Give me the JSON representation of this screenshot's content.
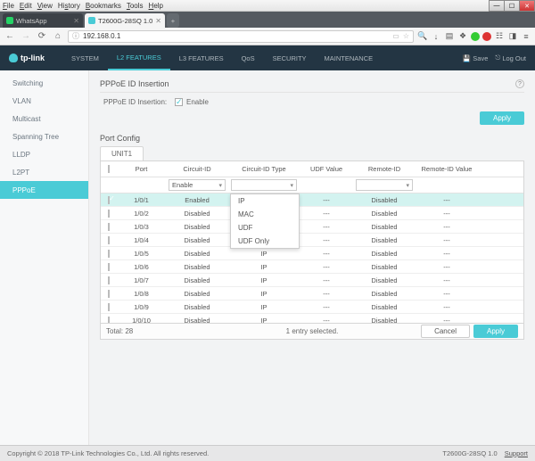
{
  "browser": {
    "menu": [
      "File",
      "Edit",
      "View",
      "History",
      "Bookmarks",
      "Tools",
      "Help"
    ],
    "tabs": [
      {
        "label": "WhatsApp",
        "active": false
      },
      {
        "label": "T2600G-28SQ 1.0",
        "active": true
      }
    ],
    "url": "192.168.0.1"
  },
  "header": {
    "brand": "tp-link",
    "nav": [
      "SYSTEM",
      "L2 FEATURES",
      "L3 FEATURES",
      "QoS",
      "SECURITY",
      "MAINTENANCE"
    ],
    "nav_active": 1,
    "save": "Save",
    "logout": "Log Out"
  },
  "sidebar": {
    "items": [
      "Switching",
      "VLAN",
      "Multicast",
      "Spanning Tree",
      "LLDP",
      "L2PT",
      "PPPoE"
    ],
    "active": 6
  },
  "page": {
    "section1_title": "PPPoE ID Insertion",
    "insertion_label": "PPPoE ID Insertion:",
    "enable_label": "Enable",
    "section2_title": "Port Config",
    "unit_tab": "UNIT1",
    "columns": [
      "",
      "Port",
      "Circuit-ID",
      "Circuit-ID Type",
      "UDF Value",
      "Remote-ID",
      "Remote-ID Value"
    ],
    "filter_circuit": "Enable",
    "circuit_type_options": [
      "IP",
      "MAC",
      "UDF",
      "UDF Only"
    ],
    "rows": [
      {
        "checked": true,
        "port": "1/0/1",
        "circuit": "Enabled",
        "type": "",
        "udf": "---",
        "remote": "Disabled",
        "rv": "---"
      },
      {
        "checked": false,
        "port": "1/0/2",
        "circuit": "Disabled",
        "type": "IP",
        "udf": "---",
        "remote": "Disabled",
        "rv": "---"
      },
      {
        "checked": false,
        "port": "1/0/3",
        "circuit": "Disabled",
        "type": "IP",
        "udf": "---",
        "remote": "Disabled",
        "rv": "---"
      },
      {
        "checked": false,
        "port": "1/0/4",
        "circuit": "Disabled",
        "type": "IP",
        "udf": "---",
        "remote": "Disabled",
        "rv": "---"
      },
      {
        "checked": false,
        "port": "1/0/5",
        "circuit": "Disabled",
        "type": "IP",
        "udf": "---",
        "remote": "Disabled",
        "rv": "---"
      },
      {
        "checked": false,
        "port": "1/0/6",
        "circuit": "Disabled",
        "type": "IP",
        "udf": "---",
        "remote": "Disabled",
        "rv": "---"
      },
      {
        "checked": false,
        "port": "1/0/7",
        "circuit": "Disabled",
        "type": "IP",
        "udf": "---",
        "remote": "Disabled",
        "rv": "---"
      },
      {
        "checked": false,
        "port": "1/0/8",
        "circuit": "Disabled",
        "type": "IP",
        "udf": "---",
        "remote": "Disabled",
        "rv": "---"
      },
      {
        "checked": false,
        "port": "1/0/9",
        "circuit": "Disabled",
        "type": "IP",
        "udf": "---",
        "remote": "Disabled",
        "rv": "---"
      },
      {
        "checked": false,
        "port": "1/0/10",
        "circuit": "Disabled",
        "type": "IP",
        "udf": "---",
        "remote": "Disabled",
        "rv": "---"
      }
    ],
    "total_label": "Total: 28",
    "selected_label": "1 entry selected.",
    "cancel": "Cancel",
    "apply": "Apply"
  },
  "footer": {
    "copyright": "Copyright © 2018   TP-Link Technologies Co., Ltd. All rights reserved.",
    "model": "T2600G-28SQ 1.0",
    "support": "Support"
  }
}
